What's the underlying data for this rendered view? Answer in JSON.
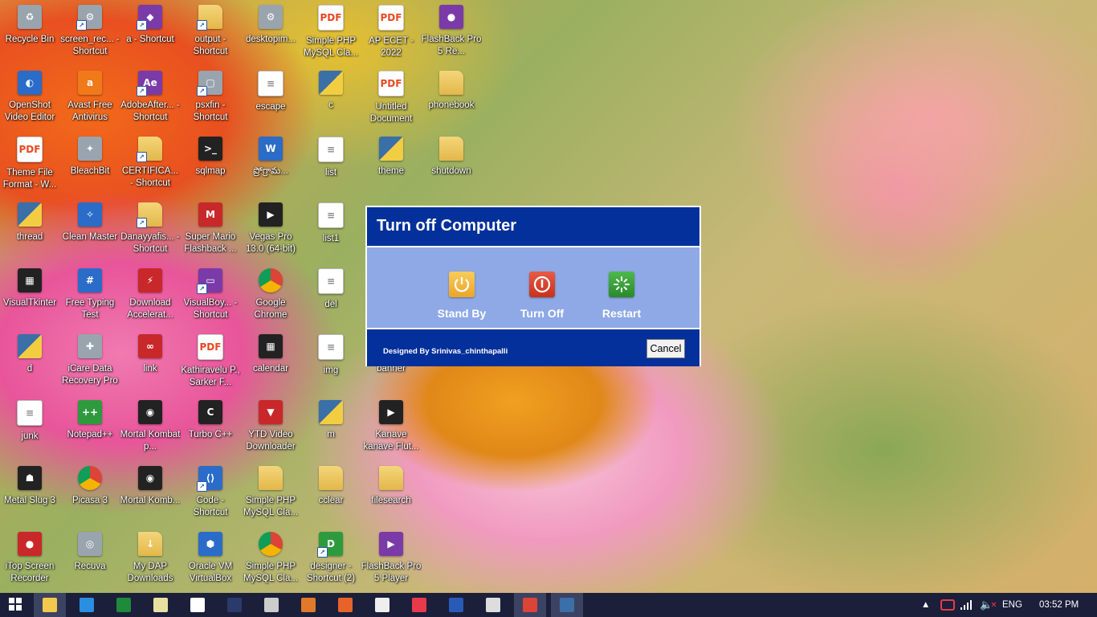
{
  "desktop_icons": [
    {
      "label": "Recycle Bin",
      "icon": "recycle-bin-icon",
      "style": "g-gray",
      "glyph": "♻"
    },
    {
      "label": "screen_rec... - Shortcut",
      "icon": "settings-shortcut-icon",
      "style": "g-gray",
      "glyph": "⚙"
    },
    {
      "label": "a - Shortcut",
      "icon": "python-shortcut-icon",
      "style": "g-purple",
      "glyph": "◆"
    },
    {
      "label": "output - Shortcut",
      "icon": "folder-shortcut-icon",
      "style": "g-folder",
      "glyph": ""
    },
    {
      "label": "desktopim...",
      "icon": "settings-file-icon",
      "style": "g-gray",
      "glyph": "⚙"
    },
    {
      "label": "Simple PHP MySQL Cla...",
      "icon": "pdf-icon",
      "style": "g-pdf",
      "glyph": "PDF"
    },
    {
      "label": "AP ECET - 2022",
      "icon": "pdf-icon",
      "style": "g-pdf",
      "glyph": "PDF"
    },
    {
      "label": "FlashBack Pro 5 Re...",
      "icon": "flashback-recorder-icon",
      "style": "g-purple",
      "glyph": "●"
    },
    {
      "label": "OpenShot Video Editor",
      "icon": "openshot-icon",
      "style": "g-blue",
      "glyph": "◐"
    },
    {
      "label": "Avast Free Antivirus",
      "icon": "avast-icon",
      "style": "g-orange",
      "glyph": "a"
    },
    {
      "label": "AdobeAfter... - Shortcut",
      "icon": "after-effects-icon",
      "style": "g-purple",
      "glyph": "Ae"
    },
    {
      "label": "psxfin - Shortcut",
      "icon": "playstation-emulator-icon",
      "style": "g-gray",
      "glyph": "▢"
    },
    {
      "label": "escape",
      "icon": "text-file-icon",
      "style": "g-doc",
      "glyph": "≡"
    },
    {
      "label": "c",
      "icon": "python-file-icon",
      "style": "g-py",
      "glyph": ""
    },
    {
      "label": "Untitled Document",
      "icon": "pdf-icon",
      "style": "g-pdf",
      "glyph": "PDF"
    },
    {
      "label": "phonebook",
      "icon": "folder-icon",
      "style": "g-folder",
      "glyph": ""
    },
    {
      "label": "Theme File Format - W...",
      "icon": "pdf-icon",
      "style": "g-pdf",
      "glyph": "PDF"
    },
    {
      "label": "BleachBit",
      "icon": "bleachbit-icon",
      "style": "g-gray",
      "glyph": "✦"
    },
    {
      "label": "CERTIFICA... - Shortcut",
      "icon": "folder-shortcut-icon",
      "style": "g-folder",
      "glyph": ""
    },
    {
      "label": "sqlmap",
      "icon": "terminal-icon",
      "style": "g-dark",
      "glyph": ">_"
    },
    {
      "label": "ప్రోగ్రామ...",
      "icon": "word-document-icon",
      "style": "g-blue",
      "glyph": "W"
    },
    {
      "label": "list",
      "icon": "text-file-icon",
      "style": "g-doc",
      "glyph": "≡"
    },
    {
      "label": "theme",
      "icon": "python-file-icon",
      "style": "g-py",
      "glyph": ""
    },
    {
      "label": "shutdown",
      "icon": "folder-icon",
      "style": "g-folder",
      "glyph": ""
    },
    {
      "label": "thread",
      "icon": "python-file-icon",
      "style": "g-py",
      "glyph": ""
    },
    {
      "label": "Clean Master",
      "icon": "clean-master-icon",
      "style": "g-blue",
      "glyph": "✧"
    },
    {
      "label": "Danayyafis... - Shortcut",
      "icon": "folder-shortcut-icon",
      "style": "g-folder",
      "glyph": ""
    },
    {
      "label": "Super Mario Flashback ...",
      "icon": "mario-game-icon",
      "style": "g-red",
      "glyph": "M"
    },
    {
      "label": "Vegas Pro 13.0 (64-bit)",
      "icon": "vegas-pro-icon",
      "style": "g-dark",
      "glyph": "▶"
    },
    {
      "label": "list1",
      "icon": "text-file-icon",
      "style": "g-doc",
      "glyph": "≡"
    },
    {
      "label": "",
      "icon": "",
      "style": "",
      "glyph": ""
    },
    {
      "label": "",
      "icon": "",
      "style": "",
      "glyph": ""
    },
    {
      "label": "VisualTkinter",
      "icon": "visual-tkinter-icon",
      "style": "g-dark",
      "glyph": "▦"
    },
    {
      "label": "Free Typing Test",
      "icon": "typing-test-icon",
      "style": "g-blue",
      "glyph": "#"
    },
    {
      "label": "Download Accelerat...",
      "icon": "download-accelerator-icon",
      "style": "g-red",
      "glyph": "⚡"
    },
    {
      "label": "VisualBoy... - Shortcut",
      "icon": "visualboy-icon",
      "style": "g-purple",
      "glyph": "▭"
    },
    {
      "label": "Google Chrome",
      "icon": "chrome-icon",
      "style": "g-chrome",
      "glyph": ""
    },
    {
      "label": "del",
      "icon": "text-file-icon",
      "style": "g-doc",
      "glyph": "≡"
    },
    {
      "label": "",
      "icon": "",
      "style": "",
      "glyph": ""
    },
    {
      "label": "",
      "icon": "",
      "style": "",
      "glyph": ""
    },
    {
      "label": "d",
      "icon": "python-file-icon",
      "style": "g-py",
      "glyph": ""
    },
    {
      "label": "iCare Data Recovery Pro",
      "icon": "icare-recovery-icon",
      "style": "g-gray",
      "glyph": "✚"
    },
    {
      "label": "link",
      "icon": "link-app-icon",
      "style": "g-red",
      "glyph": "∞"
    },
    {
      "label": "Kathiravelu P., Sarker F...",
      "icon": "pdf-icon",
      "style": "g-pdf",
      "glyph": "PDF"
    },
    {
      "label": "calendar",
      "icon": "calendar-icon",
      "style": "g-dark",
      "glyph": "▦"
    },
    {
      "label": "img",
      "icon": "text-file-icon",
      "style": "g-doc",
      "glyph": "≡"
    },
    {
      "label": "banner",
      "icon": "",
      "style": "",
      "glyph": ""
    },
    {
      "label": "",
      "icon": "",
      "style": "",
      "glyph": ""
    },
    {
      "label": "junk",
      "icon": "text-file-icon",
      "style": "g-doc",
      "glyph": "≡"
    },
    {
      "label": "Notepad++",
      "icon": "notepad-plus-icon",
      "style": "g-green",
      "glyph": "++"
    },
    {
      "label": "Mortal Kombat p...",
      "icon": "mortal-kombat-icon",
      "style": "g-dark",
      "glyph": "◉"
    },
    {
      "label": "Turbo C++",
      "icon": "turbo-cpp-icon",
      "style": "g-dark",
      "glyph": "C"
    },
    {
      "label": "YTD Video Downloader",
      "icon": "ytd-downloader-icon",
      "style": "g-red",
      "glyph": "▼"
    },
    {
      "label": "m",
      "icon": "python-file-icon",
      "style": "g-py",
      "glyph": ""
    },
    {
      "label": "Kanave kanave Flut...",
      "icon": "video-file-icon",
      "style": "g-dark",
      "glyph": "▶"
    },
    {
      "label": "",
      "icon": "",
      "style": "",
      "glyph": ""
    },
    {
      "label": "Metal Slug 3",
      "icon": "metal-slug-icon",
      "style": "g-dark",
      "glyph": "☗"
    },
    {
      "label": "Picasa 3",
      "icon": "picasa-icon",
      "style": "g-chrome",
      "glyph": ""
    },
    {
      "label": "Mortal Komb...",
      "icon": "mortal-kombat-icon",
      "style": "g-dark",
      "glyph": "◉"
    },
    {
      "label": "Code - Shortcut",
      "icon": "vscode-icon",
      "style": "g-blue",
      "glyph": "⟨⟩"
    },
    {
      "label": "Simple PHP MySQL Cla...",
      "icon": "folder-icon",
      "style": "g-folder",
      "glyph": ""
    },
    {
      "label": "cclear",
      "icon": "folder-icon",
      "style": "g-folder",
      "glyph": ""
    },
    {
      "label": "filesearch",
      "icon": "folder-icon",
      "style": "g-folder",
      "glyph": ""
    },
    {
      "label": "",
      "icon": "",
      "style": "",
      "glyph": ""
    },
    {
      "label": "iTop Screen Recorder",
      "icon": "itop-recorder-icon",
      "style": "g-red",
      "glyph": "●"
    },
    {
      "label": "Recuva",
      "icon": "recuva-icon",
      "style": "g-gray",
      "glyph": "◎"
    },
    {
      "label": "My DAP Downloads",
      "icon": "folder-download-icon",
      "style": "g-folder",
      "glyph": "↓"
    },
    {
      "label": "Oracle VM VirtualBox",
      "icon": "virtualbox-icon",
      "style": "g-blue",
      "glyph": "⬢"
    },
    {
      "label": "Simple PHP MySQL Cla...",
      "icon": "chrome-icon",
      "style": "g-chrome",
      "glyph": ""
    },
    {
      "label": "designer - Shortcut (2)",
      "icon": "qt-designer-icon",
      "style": "g-green",
      "glyph": "D"
    },
    {
      "label": "FlashBack Pro 5 Player",
      "icon": "flashback-player-icon",
      "style": "g-purple",
      "glyph": "▶"
    },
    {
      "label": "",
      "icon": "",
      "style": "",
      "glyph": ""
    }
  ],
  "dialog": {
    "title": "Turn off Computer",
    "standby_label": "Stand By",
    "turnoff_label": "Turn Off",
    "restart_label": "Restart",
    "credit": "Designed By Srinivas_chinthapalli",
    "cancel_label": "Cancel",
    "colors": {
      "header": "#03309a",
      "body": "#8fa9e6",
      "standby": "#f4b63a",
      "turnoff": "#d9452f",
      "restart": "#3a9a3a"
    }
  },
  "taskbar": {
    "language": "ENG",
    "clock": "03:52 PM",
    "apps": [
      {
        "name": "windows-start-icon",
        "color": "#ffffff",
        "active": false
      },
      {
        "name": "file-explorer-icon",
        "color": "#f2c94c",
        "active": true
      },
      {
        "name": "internet-explorer-icon",
        "color": "#2a8fe0",
        "active": false
      },
      {
        "name": "excel-icon",
        "color": "#1e8a3a",
        "active": false
      },
      {
        "name": "notepad-icon",
        "color": "#e8e0a0",
        "active": false
      },
      {
        "name": "home-icon",
        "color": "#ffffff",
        "active": false
      },
      {
        "name": "photoshop-icon",
        "color": "#2a3a6a",
        "active": false
      },
      {
        "name": "hp-icon",
        "color": "#cccccc",
        "active": false
      },
      {
        "name": "photos-icon",
        "color": "#e07a2a",
        "active": false
      },
      {
        "name": "firefox-icon",
        "color": "#e8632a",
        "active": false
      },
      {
        "name": "camera-app-icon",
        "color": "#eeeeee",
        "active": false
      },
      {
        "name": "screen-recorder-icon",
        "color": "#e83a4a",
        "active": false
      },
      {
        "name": "word-icon",
        "color": "#2a5ab8",
        "active": false
      },
      {
        "name": "unity-icon",
        "color": "#dddddd",
        "active": false
      },
      {
        "name": "chrome-taskbar-icon",
        "color": "#db4437",
        "active": true
      },
      {
        "name": "python-idle-icon",
        "color": "#3a6fa8",
        "active": true
      }
    ]
  }
}
